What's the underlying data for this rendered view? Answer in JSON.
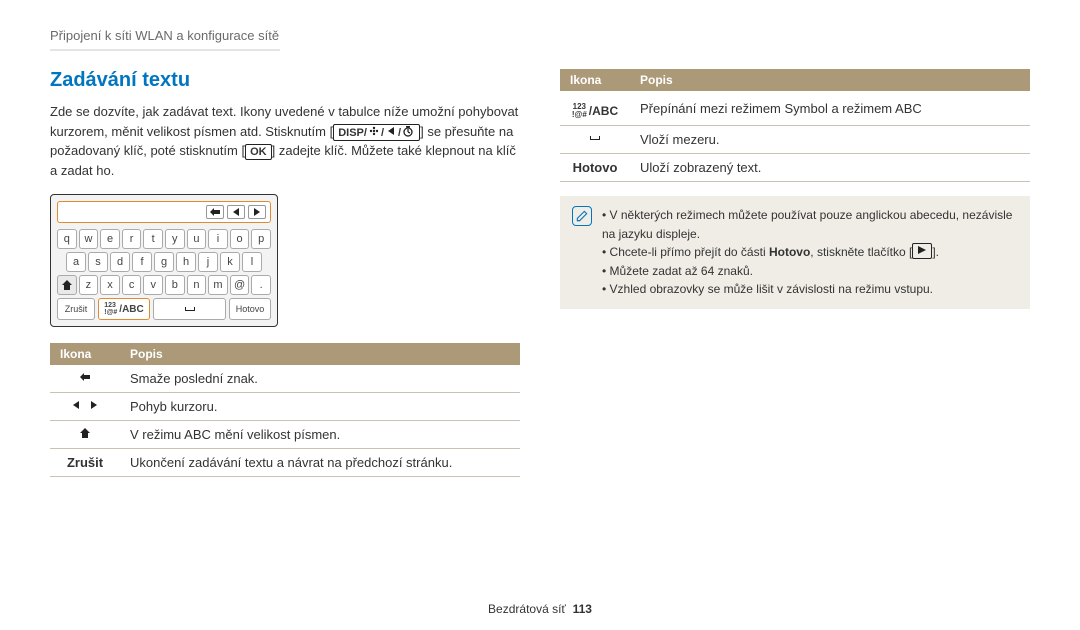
{
  "breadcrumb": "Připojení k síti WLAN a konfigurace sítě",
  "section_title": "Zadávání textu",
  "intro_pre": "Zde se dozvíte, jak zadávat text. Ikony uvedené v tabulce níže umožní pohybovat kurzorem, měnit velikost písmen atd. Stisknutím [",
  "intro_mid": "] se přesuňte na požadovaný klíč, poté stisknutím [",
  "intro_ok": "OK",
  "intro_post": "] zadejte klíč. Můžete také klepnout na klíč a zadat ho.",
  "disp_label": "DISP",
  "keyboard": {
    "row1": [
      "q",
      "w",
      "e",
      "r",
      "t",
      "y",
      "u",
      "i",
      "o",
      "p"
    ],
    "row2": [
      "a",
      "s",
      "d",
      "f",
      "g",
      "h",
      "j",
      "k",
      "l"
    ],
    "row3": [
      "z",
      "x",
      "c",
      "v",
      "b",
      "n",
      "m",
      "@",
      "."
    ],
    "cancel": "Zrušit",
    "mode_top": "123",
    "mode_bottom": "!@#",
    "mode_suffix": "/ABC",
    "done": "Hotovo"
  },
  "table_headers": {
    "icon": "Ikona",
    "desc": "Popis"
  },
  "left_rows": [
    {
      "icon_svg": "back",
      "desc": "Smaže poslední znak."
    },
    {
      "icon_svg": "leftright",
      "desc": "Pohyb kurzoru."
    },
    {
      "icon_svg": "shift",
      "desc": "V režimu ABC mění velikost písmen."
    },
    {
      "icon_text": "Zrušit",
      "desc": "Ukončení zadávání textu a návrat na předchozí stránku."
    }
  ],
  "right_rows": [
    {
      "icon_mode": true,
      "desc": "Přepínání mezi režimem Symbol a režimem ABC"
    },
    {
      "icon_svg": "space",
      "desc": "Vloží mezeru."
    },
    {
      "icon_text": "Hotovo",
      "desc": "Uloží zobrazený text."
    }
  ],
  "note": {
    "items_pre": "V některých režimech můžete používat pouze anglickou abecedu, nezávisle na jazyku displeje.",
    "item2_pre": "Chcete-li přímo přejít do části ",
    "item2_bold": "Hotovo",
    "item2_mid": ", stiskněte tlačítko [",
    "item2_post": "].",
    "item3": "Můžete zadat až 64 znaků.",
    "item4": "Vzhled obrazovky se může lišit v závislosti na režimu vstupu."
  },
  "footer": {
    "label": "Bezdrátová síť",
    "page": "113"
  }
}
